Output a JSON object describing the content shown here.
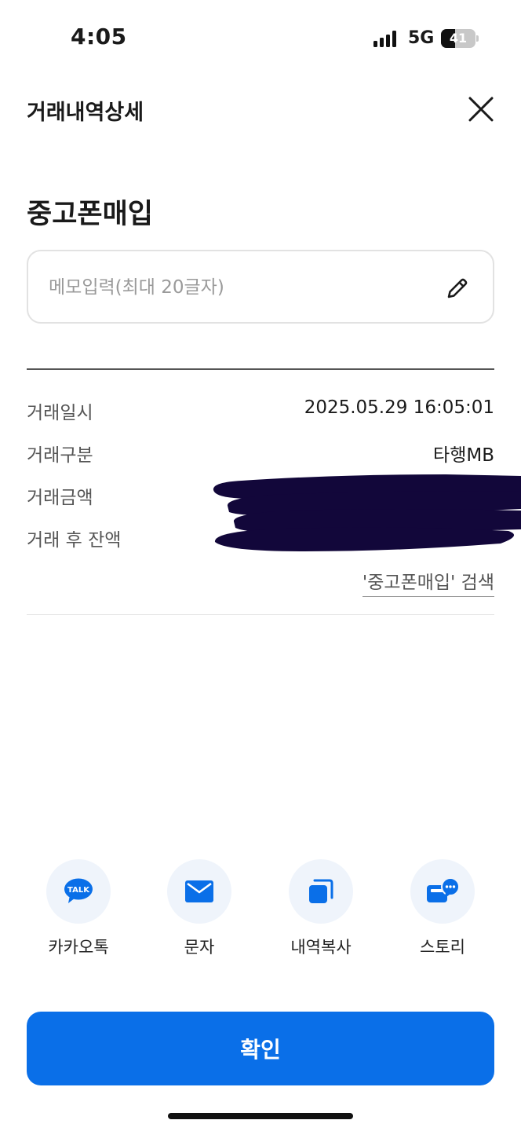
{
  "status_bar": {
    "time": "4:05",
    "network": "5G",
    "battery": "41",
    "battery_level_percent": 41
  },
  "header": {
    "title": "거래내역상세",
    "close_icon": "close-icon"
  },
  "transaction": {
    "name": "중고폰매입"
  },
  "memo": {
    "placeholder": "메모입력(최대 20글자)",
    "value": "",
    "edit_icon": "pencil-icon"
  },
  "details": [
    {
      "label": "거래일시",
      "value": "2025.05.29 16:05:01"
    },
    {
      "label": "거래구분",
      "value": "타행MB"
    },
    {
      "label": "거래금액",
      "value": ""
    },
    {
      "label": "거래 후 잔액",
      "value": ""
    }
  ],
  "search_link": "'중고폰매입' 검색",
  "share": [
    {
      "label": "카카오톡",
      "icon": "kakaotalk-icon",
      "icon_text": "TALK"
    },
    {
      "label": "문자",
      "icon": "mail-icon"
    },
    {
      "label": "내역복사",
      "icon": "copy-icon"
    },
    {
      "label": "스토리",
      "icon": "story-icon"
    }
  ],
  "confirm_label": "확인",
  "colors": {
    "accent": "#0a6fe8",
    "icon_bg": "#eff4fb",
    "redaction": "#12073a"
  }
}
